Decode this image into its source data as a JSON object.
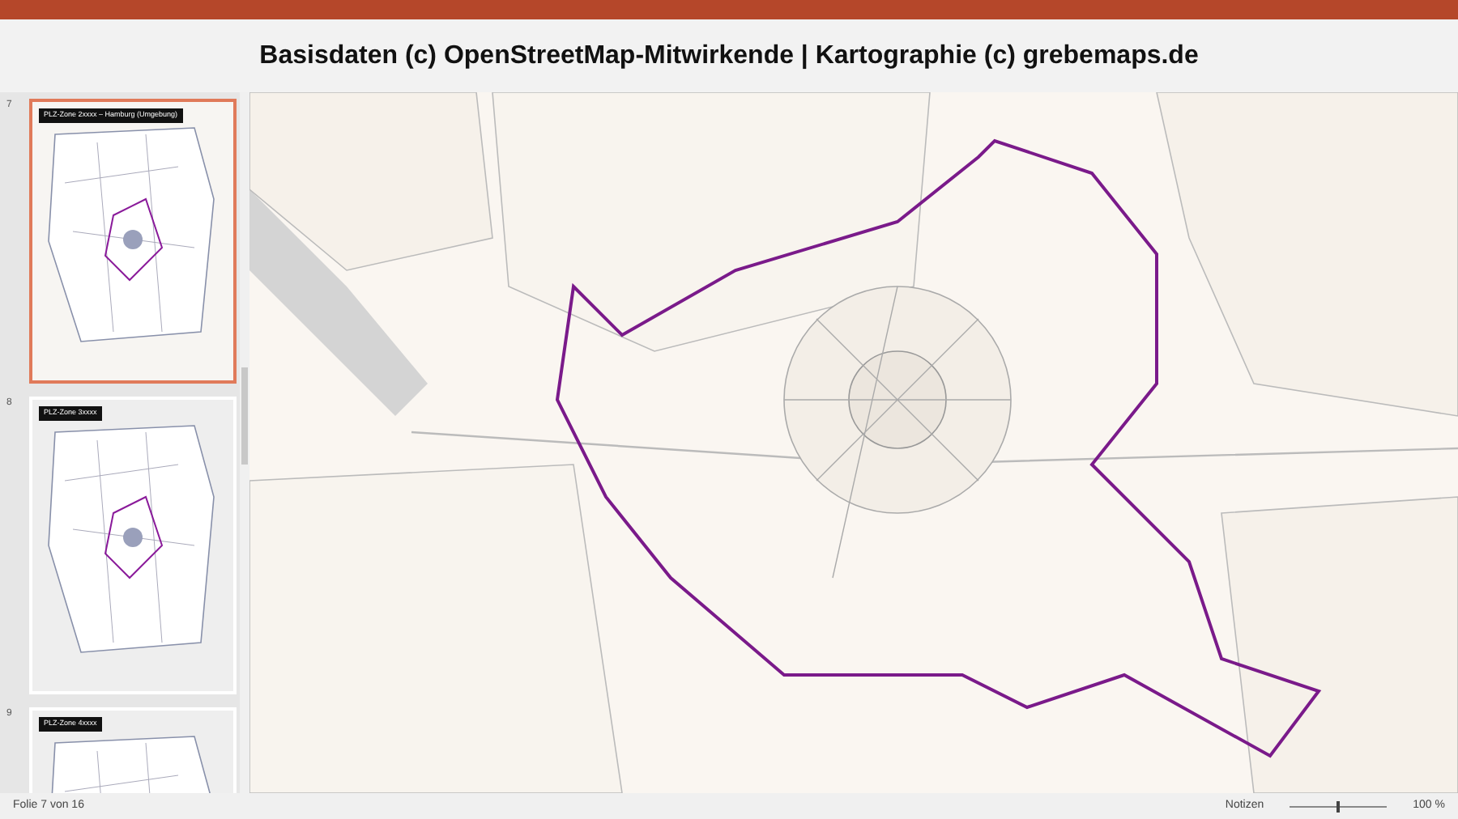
{
  "caption": "Basisdaten (c) OpenStreetMap-Mitwirkende | Kartographie (c) grebemaps.de",
  "slides": [
    {
      "number": "7",
      "title": "PLZ-Zone 2xxxx – Hamburg (Umgebung)",
      "selected": true
    },
    {
      "number": "8",
      "title": "PLZ-Zone 3xxxx",
      "selected": false
    },
    {
      "number": "9",
      "title": "PLZ-Zone 4xxxx",
      "selected": false
    }
  ],
  "status_bar": {
    "slide_info": "Folie 7 von 16",
    "notes": "Notizen",
    "zoom": "100 %",
    "zoom_slider": {
      "level": 0.5
    }
  }
}
